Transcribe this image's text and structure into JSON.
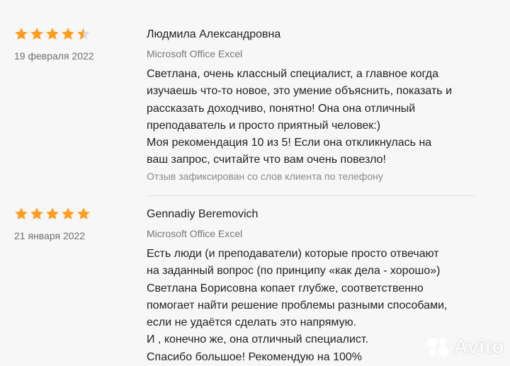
{
  "reviews": [
    {
      "rating": 4.5,
      "date": "19 февраля 2022",
      "author": "Людмила Александровна",
      "subject": "Microsoft Office Excel",
      "text": "Светлана, очень классный специалист, а главное когда\nизучаешь что-то новое, это умение объяснить, показать и\nрассказать доходчиво, понятно! Она она отличный\nпреподаватель и просто приятный человек:)\nМоя рекомендация 10 из 5! Если она откликнулась на\nваш запрос, считайте что вам очень повезло!",
      "note": "Отзыв зафиксирован со слов клиента по телефону"
    },
    {
      "rating": 5,
      "date": "21 января 2022",
      "author": "Gennadiy Beremovich",
      "subject": "Microsoft Office Excel",
      "text": "Есть люди (и преподаватели) которые просто отвечают\nна заданный вопрос (по принципу «как дела - хорошо»)\nСветлана Борисовна копает глубже, соответственно\nпомогает найти решение проблемы разными способами,\nесли не удаётся сделать это напрямую.\nИ , конечно же, она отличный специалист.\nСпасибо большое! Рекомендую на 100%"
    }
  ],
  "colors": {
    "star": "#ff9d1e",
    "star_empty": "#dcdcdc"
  },
  "watermark": "Avito"
}
